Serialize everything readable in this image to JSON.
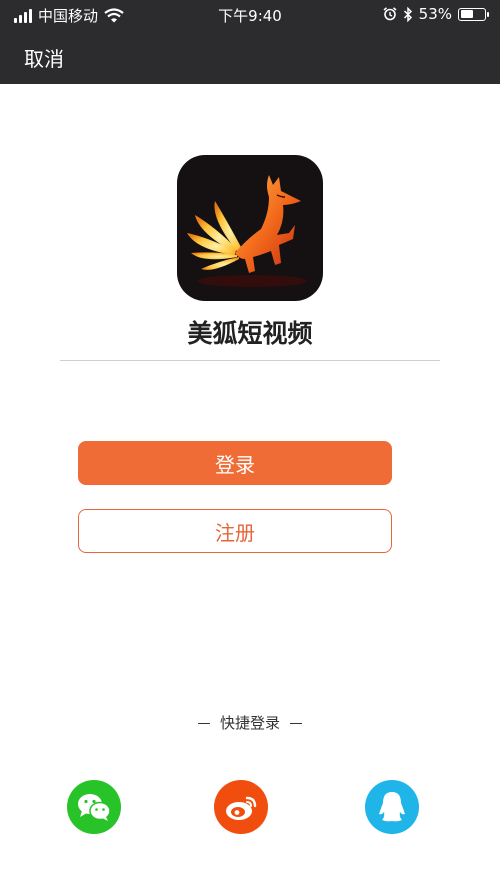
{
  "status_bar": {
    "carrier": "中国移动",
    "time": "下午9:40",
    "battery_percent": "53%",
    "battery_level": 0.53
  },
  "nav": {
    "cancel_label": "取消"
  },
  "app": {
    "name": "美狐短视频"
  },
  "buttons": {
    "login_label": "登录",
    "register_label": "注册"
  },
  "quick_login": {
    "label": "快捷登录",
    "providers": [
      "wechat-icon",
      "weibo-icon",
      "qq-icon"
    ]
  },
  "colors": {
    "topbar": "#2c2c2e",
    "accent": "#f06c37",
    "wechat": "#27c328",
    "weibo": "#f14d0e",
    "qq": "#1fb5e8"
  }
}
